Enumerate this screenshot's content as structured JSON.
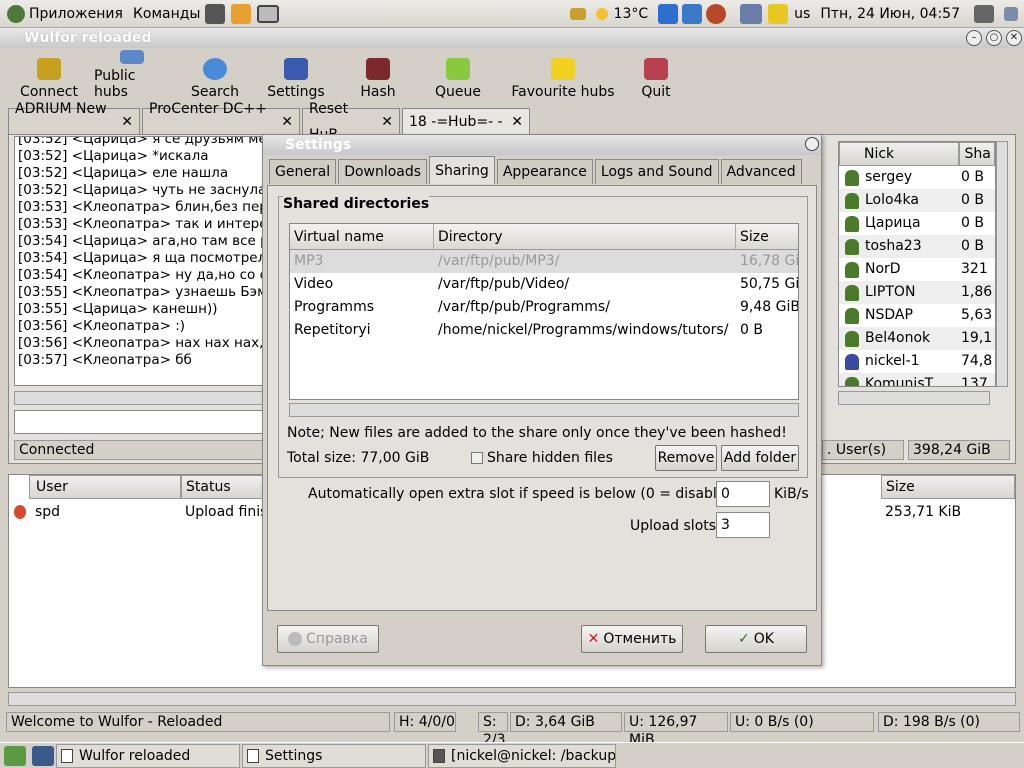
{
  "panel": {
    "menu_apps": "Приложения",
    "menu_commands": "Команды",
    "weather": "13°C",
    "keyboard": "us",
    "datetime": "Птн, 24 Июн, 04:57"
  },
  "window": {
    "title": "Wulfor reloaded"
  },
  "toolbar": {
    "connect": "Connect",
    "public_hubs": "Public hubs",
    "search": "Search",
    "settings": "Settings",
    "hash": "Hash",
    "queue": "Queue",
    "favourite_hubs": "Favourite hubs",
    "quit": "Quit"
  },
  "hub_tabs": [
    {
      "label": "ADRIUM New -"
    },
    {
      "label": "ProCenter DC++ ..."
    },
    {
      "label": "Reset HuB"
    },
    {
      "label": "18 -=Hub=- -"
    }
  ],
  "chat": {
    "lines": [
      "[03:52] <Царица> я се друзьям ме",
      "[03:52] <Царица> *искала",
      "[03:52] <Царица> еле нашла",
      "[03:52] <Царица> чуть не заснула",
      "[03:53] <Клеопатра> блин,без пере",
      "[03:53] <Клеопатра> так и интерес",
      "[03:54] <Царица> ага,но там все р",
      "[03:54] <Царица> я ща посмотрела",
      "[03:54] <Клеопатра> ну да,но со с",
      "[03:55] <Клеопатра> узнаешь Бэма",
      "[03:55] <Царица> канешн))",
      "[03:56] <Клеопатра>  :)",
      "[03:56] <Клеопатра> нах нах нах,я",
      "[03:57] <Клеопатра> бб"
    ],
    "status": "Connected"
  },
  "users": {
    "col_nick": "Nick",
    "col_share": "Sha",
    "rows": [
      {
        "nick": "sergey",
        "share": "0 B"
      },
      {
        "nick": "Lolo4ka",
        "share": "0 B"
      },
      {
        "nick": "Царица",
        "share": "0 B"
      },
      {
        "nick": "tosha23",
        "share": "0 B"
      },
      {
        "nick": "NorD",
        "share": "321"
      },
      {
        "nick": "LIPTON",
        "share": "1,86"
      },
      {
        "nick": "NSDAP",
        "share": "5,63"
      },
      {
        "nick": "Bel4onok",
        "share": "19,1"
      },
      {
        "nick": "nickel-1",
        "share": "74,8"
      },
      {
        "nick": "KomunisT",
        "share": "137"
      }
    ],
    "count_label": ". User(s)",
    "total_share": "398,24 GiB"
  },
  "transfers": {
    "col_user": "User",
    "col_status": "Status",
    "col_size": "Size",
    "rows": [
      {
        "user": "spd",
        "status": "Upload finis",
        "size": "253,71 KiB"
      }
    ]
  },
  "statusbar": {
    "welcome": "Welcome to Wulfor - Reloaded",
    "hubs": "H: 4/0/0",
    "slots": "S: 2/3",
    "downloaded": "D: 3,64 GiB",
    "uploaded": "U: 126,97 MiB",
    "upload_speed": "U: 0 B/s (0)",
    "download_speed": "D: 198 B/s (0)"
  },
  "dialog": {
    "title": "Settings",
    "tabs": [
      "General",
      "Downloads",
      "Sharing",
      "Appearance",
      "Logs and Sound",
      "Advanced"
    ],
    "shared_dirs_title": "Shared directories",
    "col_virtual": "Virtual name",
    "col_directory": "Directory",
    "col_size": "Size",
    "rows": [
      {
        "name": "MP3",
        "dir": "/var/ftp/pub/MP3/",
        "size": "16,78 GiB"
      },
      {
        "name": "Video",
        "dir": "/var/ftp/pub/Video/",
        "size": "50,75 GiB"
      },
      {
        "name": "Programms",
        "dir": "/var/ftp/pub/Programms/",
        "size": "9,48 GiB"
      },
      {
        "name": "Repetitoryi",
        "dir": "/home/nickel/Programms/windows/tutors/",
        "size": "0 B"
      }
    ],
    "note": "Note; New files are added to the share only once they've been hashed!",
    "total_size": "Total size: 77,00 GiB",
    "share_hidden": "Share hidden files",
    "remove": "Remove",
    "add_folder": "Add folder",
    "extra_slot_label": "Automatically open extra slot if speed is below (0 = disable)",
    "extra_slot_value": "0",
    "extra_slot_unit": "KiB/s",
    "upload_slots_label": "Upload slots",
    "upload_slots_value": "3",
    "help": "Справка",
    "cancel": "Отменить",
    "ok": "OK"
  },
  "taskbar": {
    "items": [
      "Wulfor reloaded",
      "Settings",
      "[nickel@nickel: /backup,"
    ]
  },
  "colors": {
    "selection": "#dcdcdc",
    "user_icon": "#4a7a2a"
  }
}
